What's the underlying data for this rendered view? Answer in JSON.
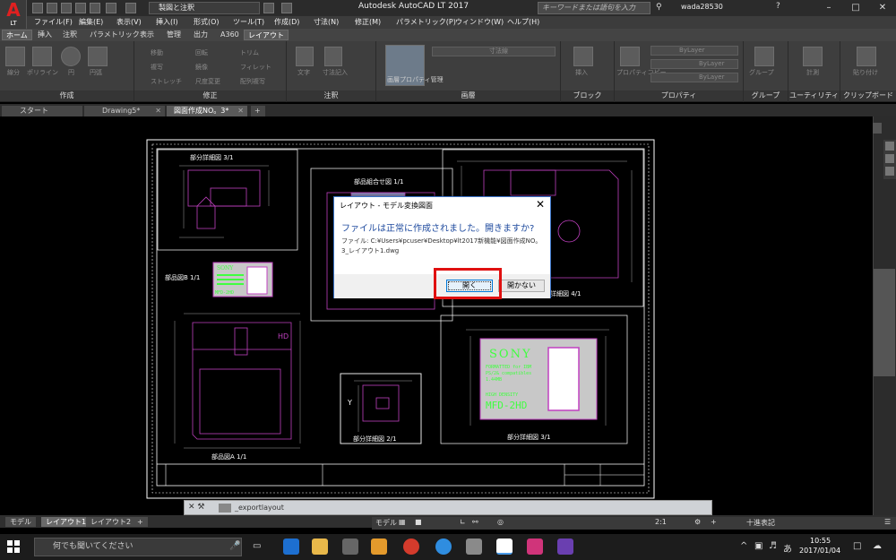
{
  "app": {
    "logo_label": "LT",
    "workspace": "製図と注釈",
    "title": "Autodesk AutoCAD LT 2017",
    "search_placeholder": "キーワードまたは語句を入力",
    "user": "wada28530"
  },
  "menu": [
    "ファイル(F)",
    "編集(E)",
    "表示(V)",
    "挿入(I)",
    "形式(O)",
    "ツール(T)",
    "作成(D)",
    "寸法(N)",
    "修正(M)",
    "パラメトリック(P)",
    "ウィンドウ(W)",
    "ヘルプ(H)"
  ],
  "ribbon_tabs": [
    "ホーム",
    "挿入",
    "注釈",
    "パラメトリック",
    "表示",
    "管理",
    "出力",
    "A360",
    "レイアウト"
  ],
  "ribbon_groups": {
    "create": "作成",
    "modify": "修正",
    "annotate": "注釈",
    "layers": "画層",
    "block": "ブロック",
    "properties": "プロパティ",
    "groups": "グループ",
    "utilities": "ユーティリティ",
    "clipboard": "クリップボード"
  },
  "ribbon_small": {
    "line": "線分",
    "polyline": "ポリライン",
    "circle": "円",
    "arc": "円弧",
    "move": "移動",
    "rotate": "回転",
    "trim": "トリム",
    "copy": "複写",
    "mirror": "鏡像",
    "fillet": "フィレット",
    "stretch": "ストレッチ",
    "scale": "尺度変更",
    "array": "配列複写",
    "text": "文字",
    "dimension": "寸法記入",
    "layer_props": "画層プロパティ管理",
    "layer_name": "寸法線",
    "insert": "挿入",
    "prop_match": "プロパティコピー",
    "bylayer1": "ByLayer",
    "bylayer2": "ByLayer",
    "bylayer3": "ByLayer",
    "group": "グループ",
    "measure": "計測",
    "paste": "貼り付け"
  },
  "file_tabs": [
    {
      "label": "スタート"
    },
    {
      "label": "Drawing5*"
    },
    {
      "label": "図面作成NO。3*"
    }
  ],
  "dialog": {
    "title": "レイアウト - モデル変換図面",
    "message": "ファイルは正常に作成されました。開きますか?",
    "file_line1": "ファイル: C:¥Users¥pcuser¥Desktop¥lt2017新機能¥図面作成NO。",
    "file_line2": "3_レイアウト1.dwg",
    "open": "開く",
    "dont_open": "開かない"
  },
  "drawing": {
    "detail_1": "部分詳細図 3/1",
    "assembly": "部品組合せ図 1/1",
    "part_b": "部品図B 1/1",
    "detail_4": "詳細図 4/1",
    "part_a": "部品図A 1/1",
    "detail_2": "部分詳細図 2/1",
    "detail_3": "部分詳細図 3/1",
    "label_sony": "SONY",
    "label_line1": "FORMATTED for IBM",
    "label_line2": "PS/2& compatibles",
    "label_line3": "1.44MB",
    "label_line4": "HIGH DENSITY",
    "label_model": "MFD-2HD",
    "small_sony": "SONY",
    "small_model": "MFD-2HD",
    "hd_mark": "HD",
    "y_mark": "Y"
  },
  "command": {
    "prompt": "_exportlayout"
  },
  "layout_tabs": [
    "モデル",
    "レイアウト1",
    "レイアウト2"
  ],
  "status": {
    "model": "モデル",
    "scale": "2:1",
    "standard": "十進表記"
  },
  "taskbar": {
    "search": "何でも聞いてください",
    "time": "10:55",
    "date": "2017/01/04"
  },
  "colors": {
    "magenta": "#c040c0",
    "white": "#ffffff",
    "label_green": "#40ff40",
    "autocad_red": "#e02020"
  }
}
